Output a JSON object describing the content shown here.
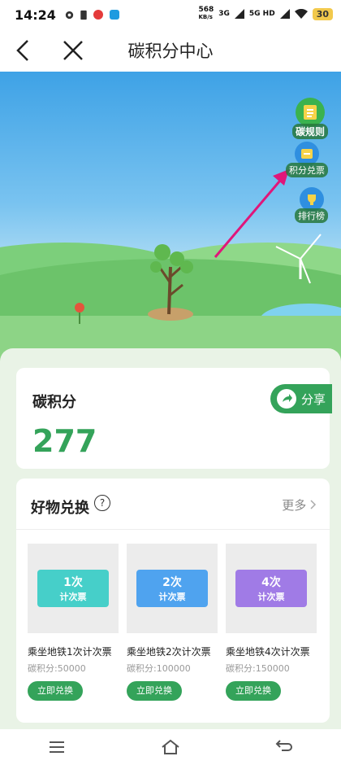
{
  "status_bar": {
    "time": "14:24",
    "net_speed_value": "568",
    "net_speed_unit": "KB/s",
    "signal1": "3G",
    "signal2": "5G HD",
    "battery": "30"
  },
  "nav": {
    "title": "碳积分中心"
  },
  "side_buttons": {
    "rules": "碳规则",
    "exchange": "积分兑票",
    "ranking": "排行榜"
  },
  "points_card": {
    "title": "碳积分",
    "value": "277",
    "share_label": "分享"
  },
  "exchange_section": {
    "title": "好物兑换",
    "help": "?",
    "more": "更多",
    "items": [
      {
        "ticket_top": "1次",
        "ticket_bottom": "计次票",
        "name": "乘坐地铁1次计次票",
        "points": "碳积分:50000",
        "button": "立即兑换",
        "color": "#46cfc9"
      },
      {
        "ticket_top": "2次",
        "ticket_bottom": "计次票",
        "name": "乘坐地铁2次计次票",
        "points": "碳积分:100000",
        "button": "立即兑换",
        "color": "#4fa3ef"
      },
      {
        "ticket_top": "4次",
        "ticket_bottom": "计次票",
        "name": "乘坐地铁4次计次票",
        "points": "碳积分:150000",
        "button": "立即兑换",
        "color": "#a07be6"
      }
    ]
  },
  "colors": {
    "accent": "#34a35a",
    "sky": "#3ea2e6",
    "annotation_arrow": "#e0167a"
  },
  "icons": [
    "back-icon",
    "close-icon",
    "rules-icon",
    "exchange-icon",
    "ranking-icon",
    "share-icon",
    "help-icon",
    "chevron-right-icon",
    "menu-icon",
    "home-icon",
    "back-nav-icon"
  ]
}
